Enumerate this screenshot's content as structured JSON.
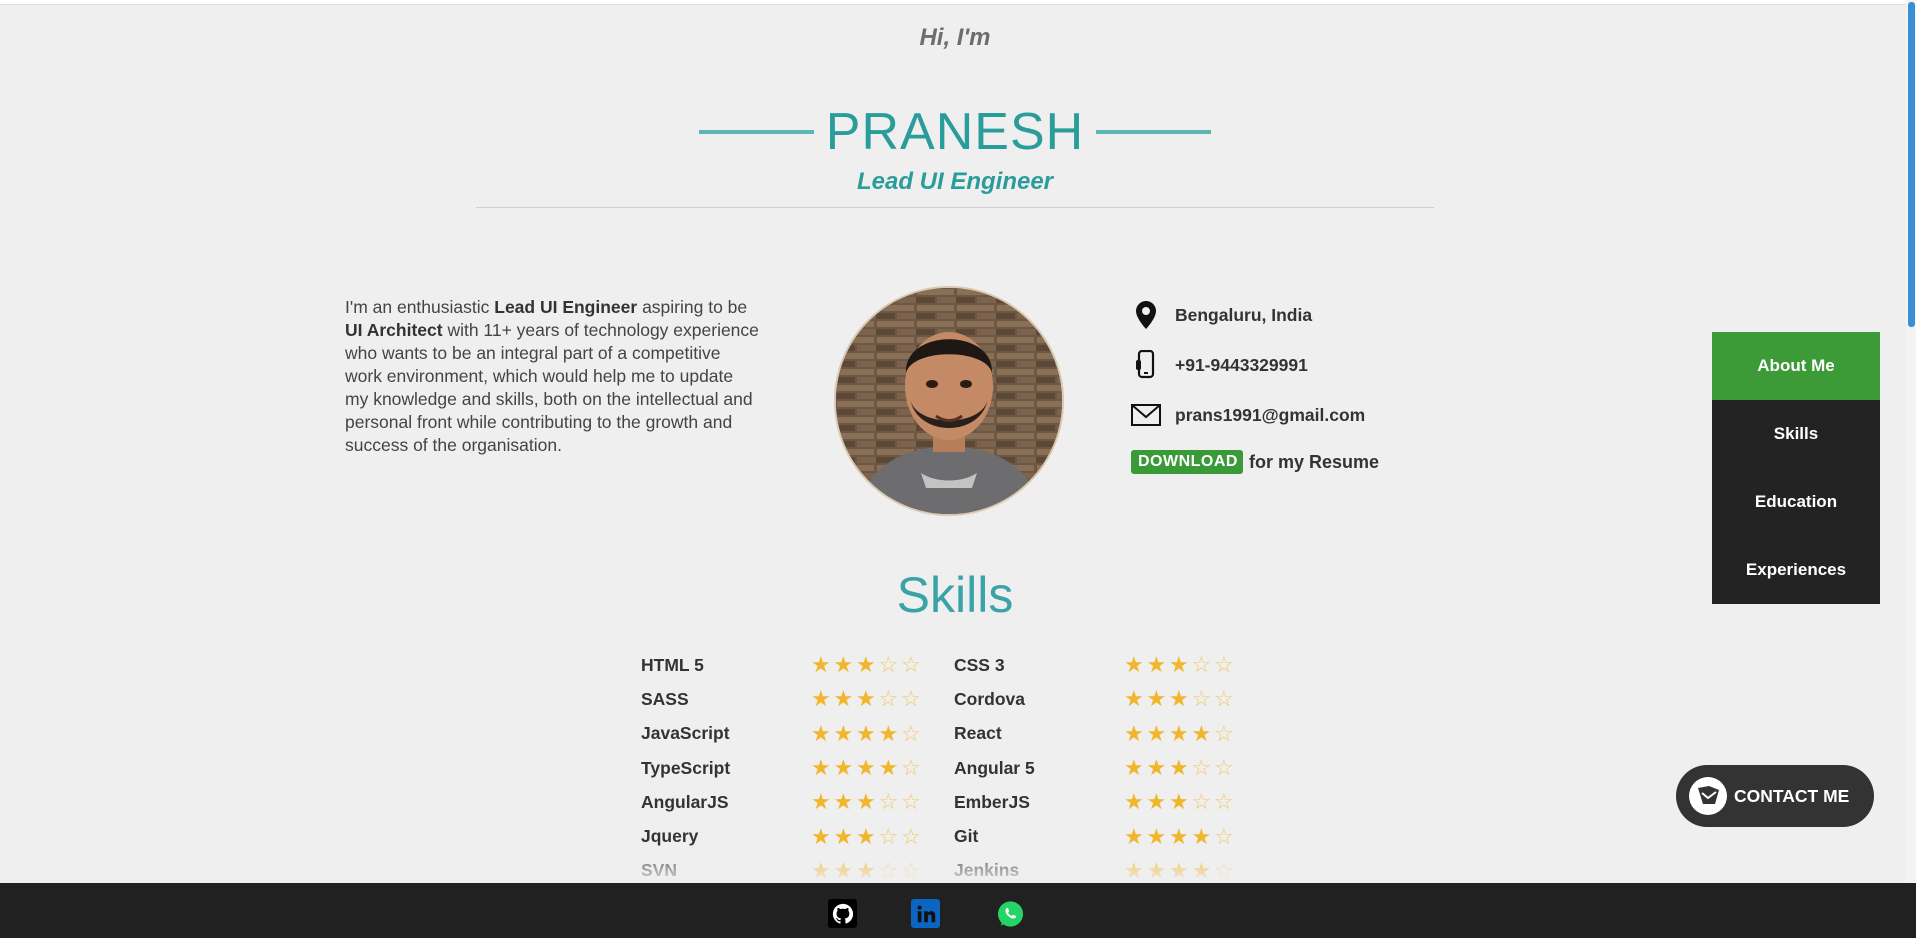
{
  "hero": {
    "greeting": "Hi, I'm",
    "name": "PRANESH",
    "role": "Lead UI Engineer"
  },
  "about": {
    "p1": "I'm an enthusiastic ",
    "b1": "Lead UI Engineer",
    "p2": " aspiring to be ",
    "b2": "UI Architect",
    "p3": " with 11+ years of technology experience who wants to be an integral part of a competitive work environment, which would help me to update my knowledge and skills, both on the intellectual and personal front while contributing to the growth and success of the organisation."
  },
  "contact": {
    "location": "Bengaluru, India",
    "phone": "+91-9443329991",
    "email": "prans1991@gmail.com",
    "download_label": "DOWNLOAD",
    "resume_text": "for my Resume"
  },
  "skills": {
    "title": "Skills",
    "max_rating": 5,
    "rows": [
      [
        {
          "name": "HTML 5",
          "rating": 3
        },
        {
          "name": "CSS 3",
          "rating": 3
        }
      ],
      [
        {
          "name": "SASS",
          "rating": 3
        },
        {
          "name": "Cordova",
          "rating": 3
        }
      ],
      [
        {
          "name": "JavaScript",
          "rating": 4
        },
        {
          "name": "React",
          "rating": 4
        }
      ],
      [
        {
          "name": "TypeScript",
          "rating": 4
        },
        {
          "name": "Angular 5",
          "rating": 3
        }
      ],
      [
        {
          "name": "AngularJS",
          "rating": 3
        },
        {
          "name": "EmberJS",
          "rating": 3
        }
      ],
      [
        {
          "name": "Jquery",
          "rating": 3
        },
        {
          "name": "Git",
          "rating": 4
        }
      ],
      [
        {
          "name": "SVN",
          "rating": 3
        },
        {
          "name": "Jenkins",
          "rating": 4
        }
      ]
    ]
  },
  "side_nav": {
    "items": [
      "About Me",
      "Skills",
      "Education",
      "Experiences"
    ],
    "active_index": 0
  },
  "contact_me": {
    "label": "CONTACT ME"
  },
  "footer": {
    "icons": [
      "github-icon",
      "linkedin-icon",
      "whatsapp-icon"
    ]
  },
  "colors": {
    "accent": "#2a9d9b",
    "active_green": "#3c9a37",
    "star": "#f1b62c",
    "dark": "#232323"
  }
}
